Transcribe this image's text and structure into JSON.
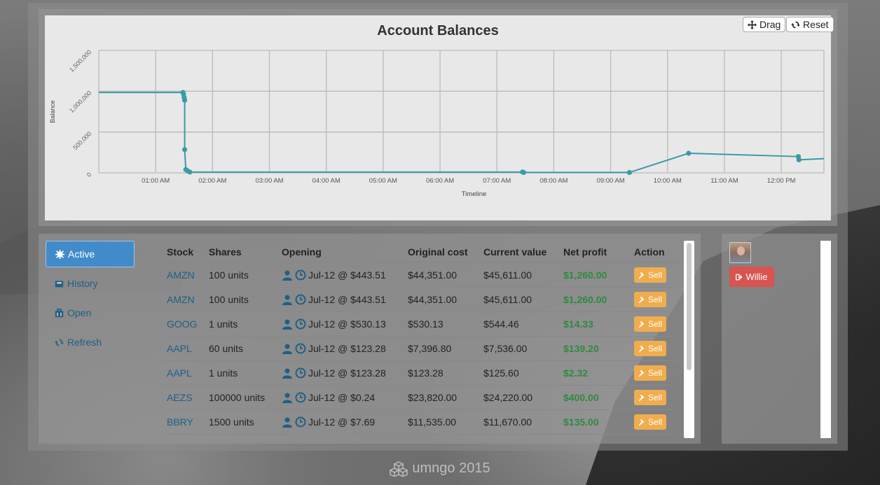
{
  "chart": {
    "title": "Account Balances",
    "drag_label": "Drag",
    "reset_label": "Reset",
    "ylabel": "Balance",
    "xlabel": "Timeline"
  },
  "chart_data": {
    "type": "line",
    "title": "Account Balances",
    "xlabel": "Timeline",
    "ylabel": "Balance",
    "y_ticks": [
      "0",
      "500,000",
      "1,000,000",
      "1,500,000"
    ],
    "x_ticks": [
      "01:00 AM",
      "02:00 AM",
      "03:00 AM",
      "04:00 AM",
      "05:00 AM",
      "06:00 AM",
      "07:00 AM",
      "08:00 AM",
      "09:00 AM",
      "10:00 AM",
      "11:00 AM",
      "12:00 PM"
    ],
    "x_tick_hours": [
      1,
      2,
      3,
      4,
      5,
      6,
      7,
      8,
      9,
      10,
      11,
      12
    ],
    "ylim": [
      0,
      1500000
    ],
    "xlim_hours": [
      0.0,
      12.75
    ],
    "grid": true,
    "color": "#3a9ba8",
    "series": [
      {
        "x_hours": [
          0.0,
          1.48,
          1.49,
          1.5,
          1.51,
          1.51,
          1.53,
          1.56,
          1.6,
          7.45,
          7.47,
          9.33,
          10.37,
          12.3,
          12.31,
          12.75
        ],
        "y": [
          985000,
          985000,
          965000,
          925000,
          890000,
          285000,
          40000,
          25000,
          10000,
          10000,
          5000,
          5000,
          240000,
          200000,
          160000,
          175000
        ],
        "markers": [
          false,
          true,
          true,
          true,
          true,
          true,
          true,
          true,
          true,
          true,
          true,
          true,
          true,
          true,
          true,
          false
        ]
      }
    ]
  },
  "nav": {
    "items": [
      {
        "label": "Active"
      },
      {
        "label": "History"
      },
      {
        "label": "Open"
      },
      {
        "label": "Refresh"
      }
    ]
  },
  "table": {
    "headers": [
      "Stock",
      "Shares",
      "Opening",
      "Original cost",
      "Current value",
      "Net profit",
      "Action"
    ],
    "sell_label": "Sell",
    "rows": [
      {
        "stock": "AMZN",
        "shares": "100 units",
        "opening": "Jul-12 @ $443.51",
        "cost": "$44,351.00",
        "value": "$45,611.00",
        "profit": "$1,260.00"
      },
      {
        "stock": "AMZN",
        "shares": "100 units",
        "opening": "Jul-12 @ $443.51",
        "cost": "$44,351.00",
        "value": "$45,611.00",
        "profit": "$1,260.00"
      },
      {
        "stock": "GOOG",
        "shares": "1 units",
        "opening": "Jul-12 @ $530.13",
        "cost": "$530.13",
        "value": "$544.46",
        "profit": "$14.33"
      },
      {
        "stock": "AAPL",
        "shares": "60 units",
        "opening": "Jul-12 @ $123.28",
        "cost": "$7,396.80",
        "value": "$7,536.00",
        "profit": "$139.20"
      },
      {
        "stock": "AAPL",
        "shares": "1 units",
        "opening": "Jul-12 @ $123.28",
        "cost": "$123.28",
        "value": "$125.60",
        "profit": "$2.32"
      },
      {
        "stock": "AEZS",
        "shares": "100000 units",
        "opening": "Jul-12 @ $0.24",
        "cost": "$23,820.00",
        "value": "$24,220.00",
        "profit": "$400.00"
      },
      {
        "stock": "BBRY",
        "shares": "1500 units",
        "opening": "Jul-12 @ $7.69",
        "cost": "$11,535.00",
        "value": "$11,670.00",
        "profit": "$135.00"
      }
    ]
  },
  "user": {
    "name": "Willie"
  },
  "footer": {
    "text": "umngo 2015"
  },
  "colors": {
    "accent": "#428bca",
    "sell": "#f0ad4e",
    "user_button": "#d9534f",
    "profit": "#2e8b3e",
    "link": "#1f5f86"
  }
}
